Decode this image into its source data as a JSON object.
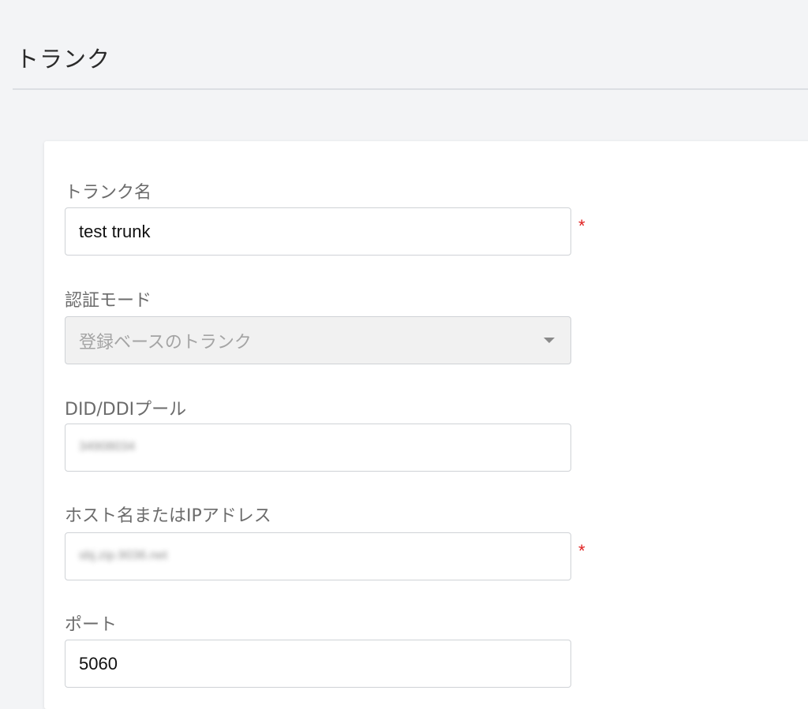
{
  "page": {
    "title": "トランク"
  },
  "form": {
    "trunk_name": {
      "label": "トランク名",
      "value": "test trunk",
      "required_mark": "*"
    },
    "auth_mode": {
      "label": "認証モード",
      "value": "登録ベースのトランク"
    },
    "did_pool": {
      "label": "DID/DDIプール",
      "value": "34908034"
    },
    "host": {
      "label": "ホスト名またはIPアドレス",
      "value": "sbj.zip.9036.net",
      "required_mark": "*"
    },
    "port": {
      "label": "ポート",
      "value": "5060"
    }
  },
  "colors": {
    "background": "#f3f4f6",
    "card": "#ffffff",
    "required": "#e02020",
    "disabled_field": "#f1f1f1"
  },
  "icons": {
    "dropdown": "chevron-down-icon"
  }
}
